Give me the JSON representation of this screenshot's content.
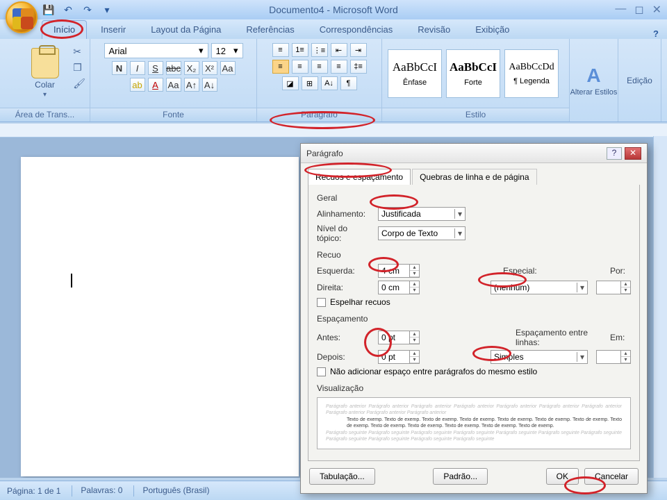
{
  "title": "Documento4 - Microsoft Word",
  "tabs": [
    "Início",
    "Inserir",
    "Layout da Página",
    "Referências",
    "Correspondências",
    "Revisão",
    "Exibição"
  ],
  "active_tab": 0,
  "ribbon": {
    "clipboard": {
      "paste": "Colar",
      "group": "Área de Trans..."
    },
    "font": {
      "name": "Arial",
      "size": "12",
      "group": "Fonte"
    },
    "paragraph": {
      "group": "Parágrafo"
    },
    "styles": {
      "group": "Estilo",
      "items": [
        {
          "sample": "AaBbCcI",
          "name": "Ênfase"
        },
        {
          "sample": "AaBbCcI",
          "name": "Forte"
        },
        {
          "sample": "AaBbCcDd",
          "name": "¶ Legenda"
        }
      ],
      "change": "Alterar Estilos"
    },
    "editing": "Edição"
  },
  "status": {
    "page": "Página: 1 de 1",
    "words": "Palavras: 0",
    "lang": "Português (Brasil)"
  },
  "dialog": {
    "title": "Parágrafo",
    "tab1": "Recuos e espaçamento",
    "tab2": "Quebras de linha e de página",
    "general": {
      "label": "Geral",
      "align_l": "Alinhamento:",
      "align_v": "Justificada",
      "level_l": "Nível do tópico:",
      "level_v": "Corpo de Texto"
    },
    "indent": {
      "label": "Recuo",
      "left_l": "Esquerda:",
      "left_v": "4 cm",
      "right_l": "Direita:",
      "right_v": "0 cm",
      "special_l": "Especial:",
      "special_v": "(nenhum)",
      "by_l": "Por:",
      "by_v": "",
      "mirror": "Espelhar recuos"
    },
    "spacing": {
      "label": "Espaçamento",
      "before_l": "Antes:",
      "before_v": "0 pt",
      "after_l": "Depois:",
      "after_v": "0 pt",
      "line_l": "Espaçamento entre linhas:",
      "line_v": "Simples",
      "at_l": "Em:",
      "at_v": "",
      "nosame": "Não adicionar espaço entre parágrafos do mesmo estilo"
    },
    "preview_label": "Visualização",
    "preview_faint": "Parágrafo anterior Parágrafo anterior Parágrafo anterior Parágrafo anterior Parágrafo anterior Parágrafo anterior Parágrafo anterior Parágrafo anterior Parágrafo anterior Parágrafo anterior",
    "preview_dark": "Texto de exemp. Texto de exemp. Texto de exemp. Texto de exemp. Texto de exemp. Texto de exemp. Texto de exemp. Texto de exemp. Texto de exemp. Texto de exemp. Texto de exemp. Texto de exemp. Texto de exemp.",
    "preview_after": "Parágrafo seguinte Parágrafo seguinte Parágrafo seguinte Parágrafo seguinte Parágrafo seguinte Parágrafo seguinte Parágrafo seguinte Parágrafo seguinte Parágrafo seguinte Parágrafo seguinte Parágrafo seguinte",
    "buttons": {
      "tabs": "Tabulação...",
      "default": "Padrão...",
      "ok": "OK",
      "cancel": "Cancelar"
    }
  }
}
